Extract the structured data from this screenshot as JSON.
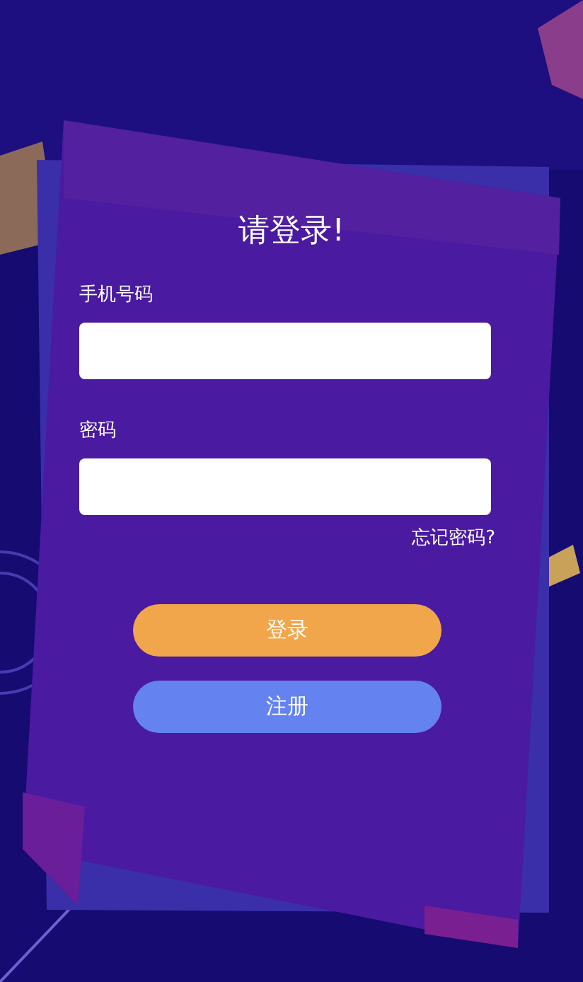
{
  "title": "请登录!",
  "fields": [
    {
      "label": "手机号码"
    },
    {
      "label": "密码"
    }
  ],
  "forgot_link": "忘记密码?",
  "buttons": [
    {
      "label": "登录",
      "kind": "primary"
    },
    {
      "label": "注册",
      "kind": "secondary"
    }
  ]
}
